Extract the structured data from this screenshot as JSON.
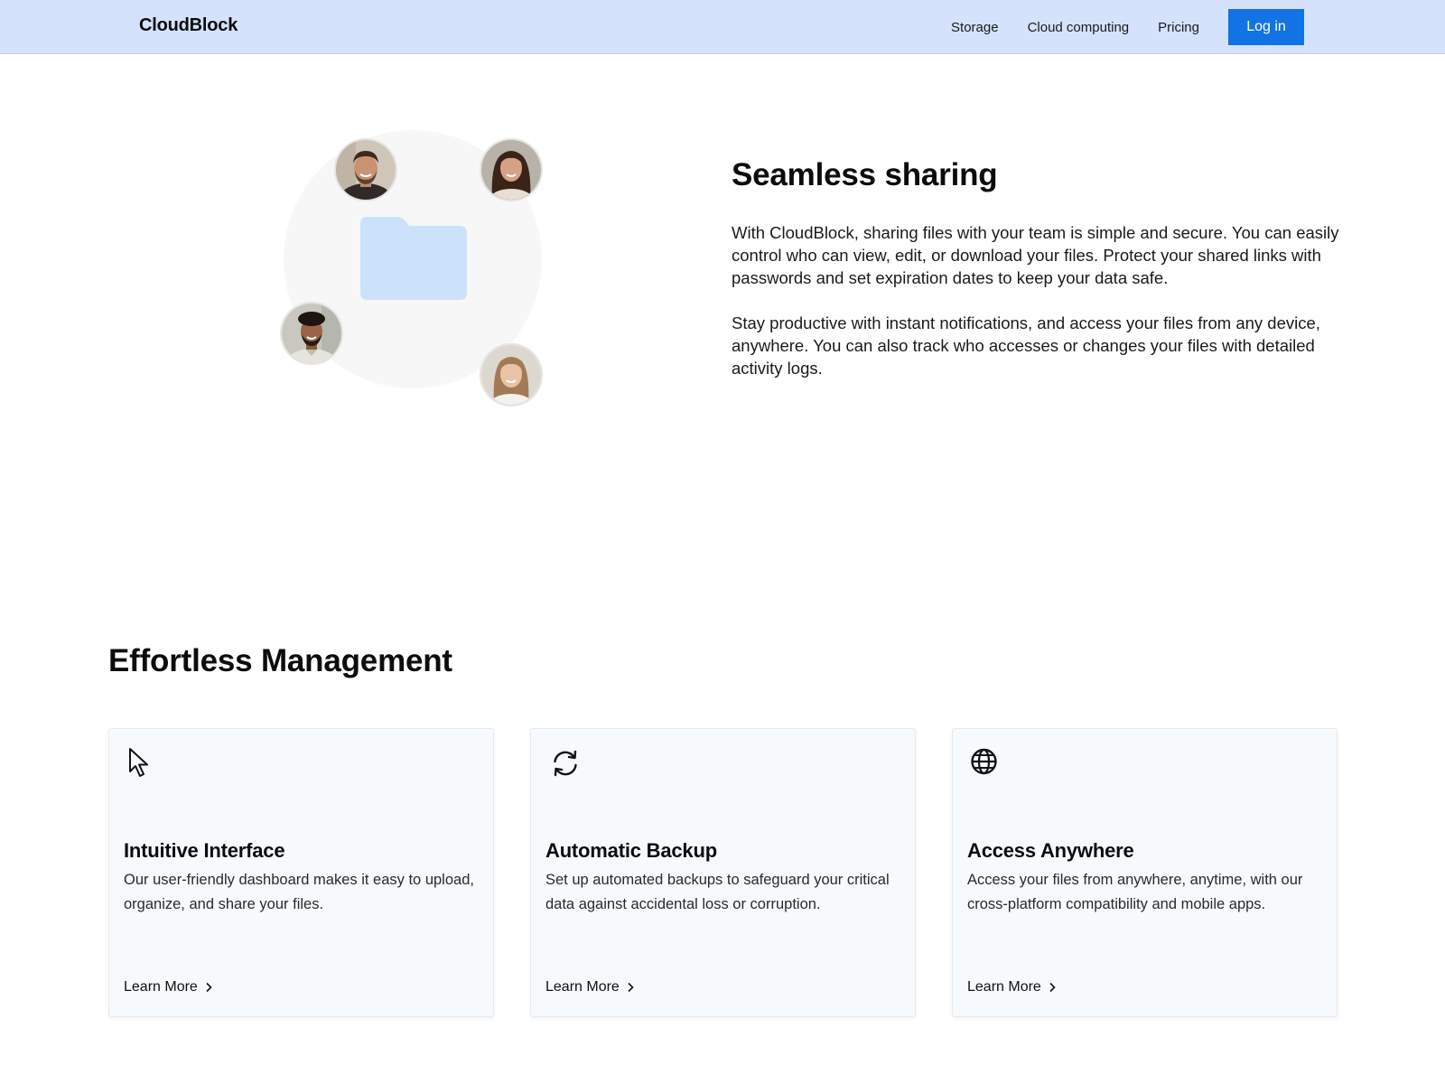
{
  "header": {
    "brand": "CloudBlock",
    "nav": [
      {
        "label": "Storage"
      },
      {
        "label": "Cloud computing"
      },
      {
        "label": "Pricing"
      }
    ],
    "login_label": "Log in"
  },
  "hero": {
    "title": "Seamless sharing",
    "paragraphs": [
      "With CloudBlock, sharing files with your team is simple and secure. You can easily control who can view, edit, or download your files. Protect your shared links with passwords and set expiration dates to keep your data safe.",
      "Stay productive with instant notifications, and access your files from any device, anywhere. You can also track who accesses or changes your files with detailed activity logs."
    ]
  },
  "features": {
    "title": "Effortless Management",
    "cards": [
      {
        "icon": "cursor-icon",
        "title": "Intuitive Interface",
        "description": "Our user-friendly dashboard makes it easy to upload, organize, and share your files.",
        "link": "Learn More"
      },
      {
        "icon": "sync-icon",
        "title": "Automatic Backup",
        "description": "Set up automated backups to safeguard your critical data against accidental loss or corruption.",
        "link": "Learn More"
      },
      {
        "icon": "globe-icon",
        "title": "Access Anywhere",
        "description": "Access your files from anywhere, anytime, with our cross-platform compatibility and mobile apps.",
        "link": "Learn More"
      }
    ]
  },
  "colors": {
    "nav_background": "#d4e2fc",
    "primary_button": "#1173e4",
    "folder": "#cce2fa",
    "card_background": "#f7fafd"
  }
}
